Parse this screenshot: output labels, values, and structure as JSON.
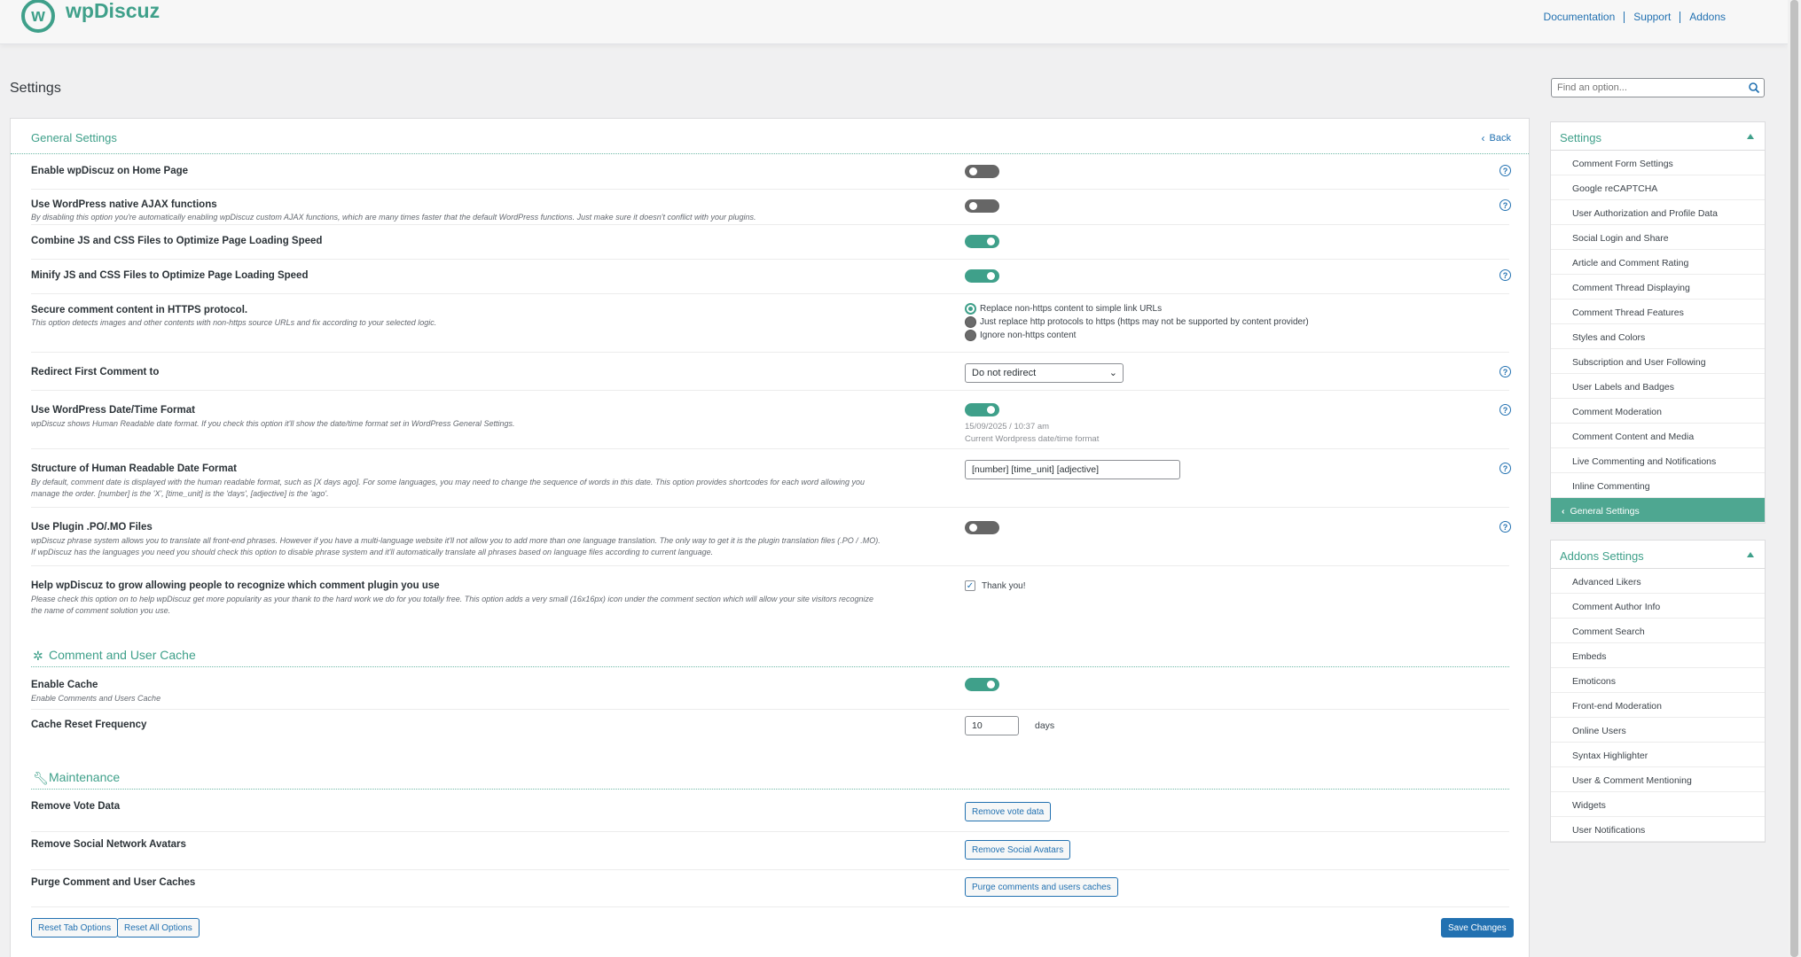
{
  "app": {
    "name": "wpDiscuz",
    "logo_letter": "w",
    "links": [
      "Documentation",
      "Support",
      "Addons"
    ]
  },
  "page": {
    "title": "Settings"
  },
  "search": {
    "placeholder": "Find an option..."
  },
  "main": {
    "title": "General Settings",
    "back_label": "Back"
  },
  "options": [
    {
      "title": "Enable wpDiscuz on Home Page",
      "desc": "",
      "state": false
    },
    {
      "title": "Use WordPress native AJAX functions",
      "desc": "By disabling this option you're automatically enabling wpDiscuz custom AJAX functions, which are many times faster that the default WordPress functions. Just make sure it doesn't conflict with your plugins.",
      "state": false
    },
    {
      "title": "Combine JS and CSS Files to Optimize Page Loading Speed",
      "desc": "",
      "state": true
    },
    {
      "title": "Minify JS and CSS Files to Optimize Page Loading Speed",
      "desc": "",
      "state": true
    },
    {
      "title": "Secure comment content in HTTPS protocol.",
      "desc": "This option detects images and other contents with non-https source URLs and fix according to your selected logic."
    },
    {
      "title": "Redirect First Comment to",
      "desc": ""
    },
    {
      "title": "Use WordPress Date/Time Format",
      "desc": "wpDiscuz shows Human Readable date format. If you check this option it'll show the date/time format set in WordPress General Settings.",
      "state": true
    },
    {
      "title": "Structure of Human Readable Date Format",
      "desc": "By default, comment date is displayed with the human readable format, such as [X days ago]. For some languages, you may need to change the sequence of words in this date. This option provides shortcodes for each word allowing you manage the order. [number] is the 'X', [time_unit] is the 'days', [adjective] is the 'ago'."
    },
    {
      "title": "Use Plugin .PO/.MO Files",
      "desc": "wpDiscuz phrase system allows you to translate all front-end phrases. However if you have a multi-language website it'll not allow you to add more than one language translation. The only way to get it is the plugin translation files (.PO / .MO). If wpDiscuz has the languages you need you should check this option to disable phrase system and it'll automatically translate all phrases based on language files according to current language.",
      "state": false
    },
    {
      "title": "Help wpDiscuz to grow allowing people to recognize which comment plugin you use",
      "desc": "Please check this option on to help wpDiscuz get more popularity as your thank to the hard work we do for you totally free. This option adds a very small (16x16px) icon under the comment section which will allow your site visitors recognize the name of comment solution you use."
    }
  ],
  "https_radios": [
    {
      "label": "Replace non-https content to simple link URLs",
      "selected": true
    },
    {
      "label": "Just replace http protocols to https (https may not be supported by content provider)",
      "selected": false
    },
    {
      "label": "Ignore non-https content",
      "selected": false
    }
  ],
  "redirect": {
    "value": "Do not redirect"
  },
  "datetime": {
    "sample": "15/09/2025 / 10:37 am",
    "note": "Current Wordpress date/time format"
  },
  "date_structure": {
    "value": "[number] [time_unit] [adjective]"
  },
  "help_checkbox": {
    "checked": true,
    "label": "Thank you!"
  },
  "cache_section": {
    "title": "Comment and User Cache",
    "enable_title": "Enable Cache",
    "enable_desc": "Enable Comments and Users Cache",
    "enable_state": true,
    "reset_title": "Cache Reset Frequency",
    "reset_value": "10",
    "reset_unit": "days"
  },
  "maintenance": {
    "title": "Maintenance",
    "rows": [
      {
        "title": "Remove Vote Data",
        "button": "Remove vote data"
      },
      {
        "title": "Remove Social Network Avatars",
        "button": "Remove Social Avatars"
      },
      {
        "title": "Purge Comment and User Caches",
        "button": "Purge comments and users caches"
      }
    ]
  },
  "footer": {
    "reset_tab": "Reset Tab Options",
    "reset_all": "Reset All Options",
    "save": "Save Changes"
  },
  "sidebar": {
    "settings_title": "Settings",
    "settings_items": [
      "Comment Form Settings",
      "Google reCAPTCHA",
      "User Authorization and Profile Data",
      "Social Login and Share",
      "Article and Comment Rating",
      "Comment Thread Displaying",
      "Comment Thread Features",
      "Styles and Colors",
      "Subscription and User Following",
      "User Labels and Badges",
      "Comment Moderation",
      "Comment Content and Media",
      "Live Commenting and Notifications",
      "Inline Commenting",
      "General Settings"
    ],
    "addons_title": "Addons Settings",
    "addons_items": [
      "Advanced Likers",
      "Comment Author Info",
      "Comment Search",
      "Embeds",
      "Emoticons",
      "Front-end Moderation",
      "Online Users",
      "Syntax Highlighter",
      "User & Comment Mentioning",
      "Widgets",
      "User Notifications"
    ]
  },
  "colors": {
    "accent": "#3fa08a",
    "link": "#2271b1",
    "active_bg": "#4ea791"
  }
}
